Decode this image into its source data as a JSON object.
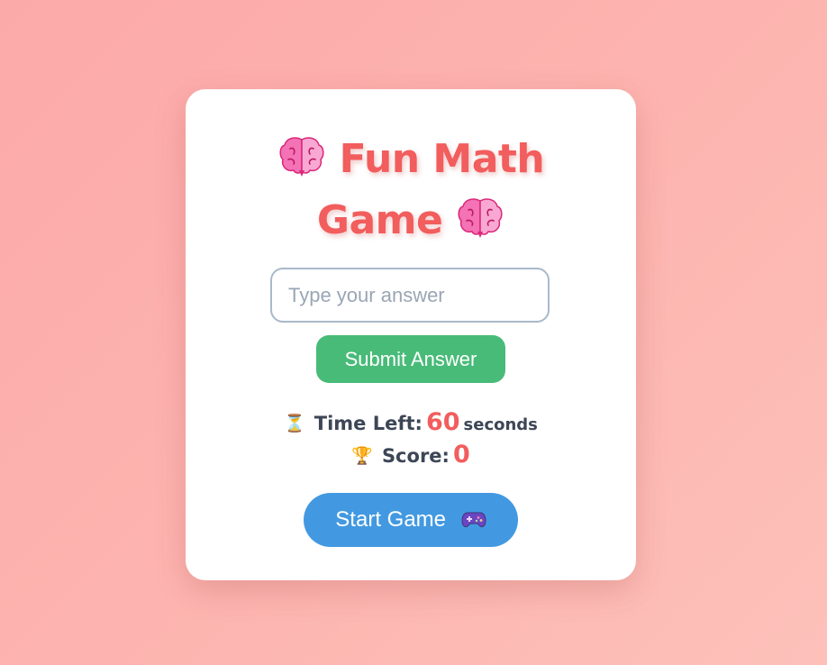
{
  "game": {
    "title_line1": "Fun Math",
    "title_line2": "Game",
    "answer_placeholder": "Type your answer",
    "submit_label": "Submit Answer",
    "time_left_label": "Time Left:",
    "time_left_value": "60",
    "time_left_unit": "seconds",
    "score_label": "Score:",
    "score_value": "0",
    "start_label": "Start Game"
  },
  "icons": {
    "title": "brain-icon",
    "timer": "hourglass-icon",
    "score": "trophy-icon",
    "start": "gamepad-icon"
  },
  "colors": {
    "title": "#f25d5d",
    "submit_button": "#48bb78",
    "start_button": "#4299e1",
    "value_highlight": "#f25d5d",
    "background": "#fcaaaa"
  }
}
